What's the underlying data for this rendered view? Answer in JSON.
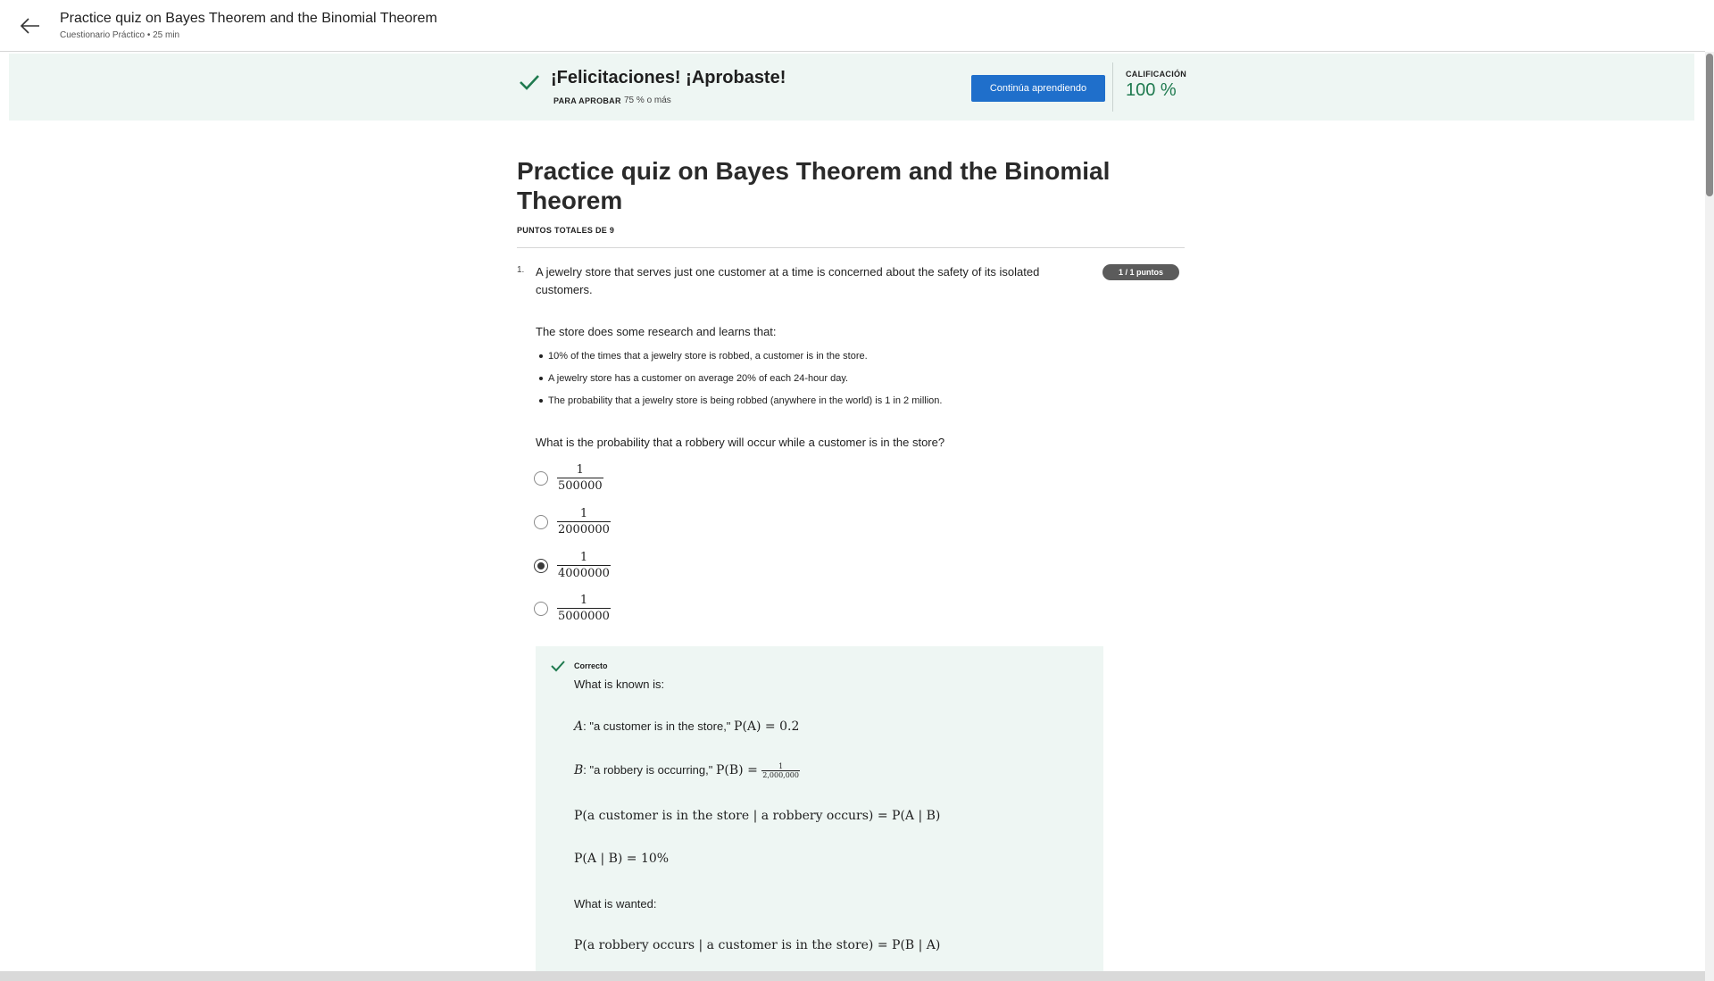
{
  "header": {
    "title": "Practice quiz on Bayes Theorem and the Binomial Theorem",
    "subtitle": "Cuestionario Práctico • 25 min"
  },
  "banner": {
    "title": "¡Felicitaciones! ¡Aprobaste!",
    "pass_label": "PARA APROBAR",
    "pass_value": "75 % o más",
    "continue_label": "Continúa aprendiendo",
    "grade_label": "CALIFICACIÓN",
    "grade_value": "100 %",
    "accent": "#1f6fcb",
    "success": "#1f7a4f"
  },
  "quiz": {
    "title": "Practice quiz on Bayes Theorem and the Binomial Theorem",
    "total_points": "PUNTOS TOTALES DE 9"
  },
  "question": {
    "number": "1.",
    "points": "1 / 1 puntos",
    "text": "A jewelry store that serves just one customer at a time is concerned about the safety of its isolated customers.",
    "intro": "The store does some research and learns that:",
    "facts": [
      "10% of the times that a jewelry store is robbed, a customer is in the store.",
      "A jewelry store has a customer on average 20% of each 24-hour day.",
      "The probability that a jewelry store is being robbed (anywhere in the world) is 1 in 2 million."
    ],
    "ask": "What is the probability that a robbery will occur while a customer is in the store?",
    "options": [
      {
        "num": "1",
        "den": "500000",
        "selected": false
      },
      {
        "num": "1",
        "den": "2000000",
        "selected": false
      },
      {
        "num": "1",
        "den": "4000000",
        "selected": true
      },
      {
        "num": "1",
        "den": "5000000",
        "selected": false
      }
    ]
  },
  "feedback": {
    "status": "Correcto",
    "known": "What is known is:",
    "lineA_var": "A",
    "lineA_text": ": \"a customer is in the store,\" ",
    "lineA_math": "P(A) = 0.2",
    "lineB_var": "B",
    "lineB_text": ": \"a robbery is occurring,\" ",
    "lineB_math": "P(B) = ",
    "lineB_num": "1",
    "lineB_den": "2,000,000",
    "line3": "P(a customer is in the store | a robbery occurs) = P(A | B)",
    "line4": "P(A | B) = 10%",
    "wanted": "What is wanted:",
    "line5": "P(a robbery occurs | a customer is in the store) = P(B | A)"
  }
}
